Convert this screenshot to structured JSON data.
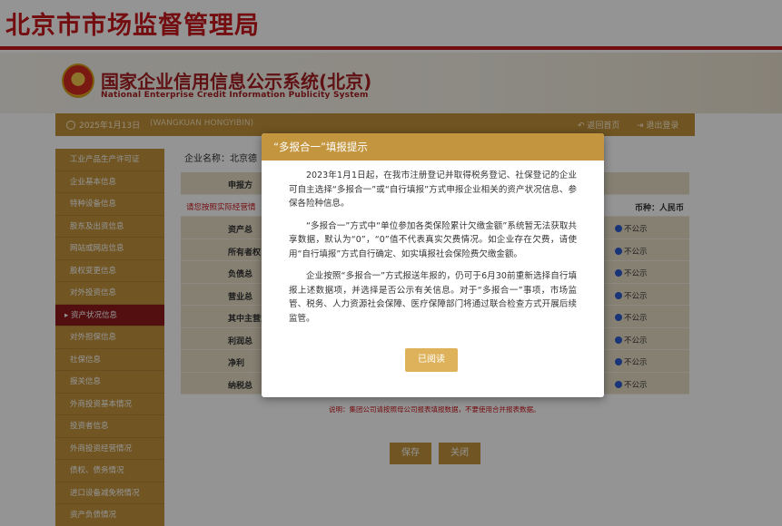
{
  "agency_title": "北京市市场监督管理局",
  "system": {
    "title": "国家企业信用信息公示系统(北京)",
    "subtitle": "National Enterprise Credit Information Publicity System"
  },
  "toolbar": {
    "date": "2025年1月13日",
    "user": "(WANGKUAN HONGYIBIN)",
    "home_label": "返回首页",
    "logout_label": "退出登录"
  },
  "sidebar": {
    "items": [
      {
        "label": "工业产品生产许可证"
      },
      {
        "label": "企业基本信息"
      },
      {
        "label": "特种设备信息"
      },
      {
        "label": "股东及出资信息"
      },
      {
        "label": "网站或网店信息"
      },
      {
        "label": "股权变更信息"
      },
      {
        "label": "对外投资信息"
      },
      {
        "label": "资产状况信息"
      },
      {
        "label": "对外担保信息"
      },
      {
        "label": "社保信息"
      },
      {
        "label": "报关信息"
      },
      {
        "label": "外商投资基本情况"
      },
      {
        "label": "投资者信息"
      },
      {
        "label": "外商投资经营情况"
      },
      {
        "label": "债权、债务情况"
      },
      {
        "label": "进口设备减免税情况"
      },
      {
        "label": "资产负债情况"
      }
    ]
  },
  "content": {
    "company_label": "企业名称：",
    "company_value": "北京德",
    "warning_text": "请您按照实际经营情",
    "currency": "币种：人民币",
    "rows": [
      {
        "label": "申报方"
      },
      {
        "label": "资产总"
      },
      {
        "label": "所有者权"
      },
      {
        "label": "负债总"
      },
      {
        "label": "营业总"
      },
      {
        "label": "其中主营业"
      },
      {
        "label": "利润总"
      },
      {
        "label": "净利"
      },
      {
        "label": "纳税总"
      }
    ],
    "radio_label": "不公示",
    "note": "说明：集团公司请按照母公司报表填报数据，不要使用合并报表数据。",
    "save_label": "保存",
    "close_label": "关闭"
  },
  "modal": {
    "title": "“多报合一”填报提示",
    "paragraphs": [
      "2023年1月1日起，在我市注册登记并取得税务登记、社保登记的企业可自主选择“多报合一”或“自行填报”方式申报企业相关的资产状况信息、参保各险种信息。",
      "“多报合一”方式中“单位参加各类保险累计欠缴金额”系统暂无法获取共享数据，默认为“0”，“0”值不代表真实欠费情况。如企业存在欠费，请使用“自行填报”方式自行确定、如实填报社会保险费欠缴金额。",
      "企业按照“多报合一”方式报送年报的，仍可于6月30前重新选择自行填报上述数据项，并选择是否公示有关信息。对于“多报合一”事项，市场监管、税务、人力资源社会保障、医疗保障部门将通过联合检查方式开展后续监管。"
    ],
    "ack_label": "已阅读"
  },
  "colors": {
    "brand_red": "#c8171d",
    "gold": "#c3953f",
    "active_item": "#8f1b1d",
    "radio_blue": "#2b5ccf"
  }
}
